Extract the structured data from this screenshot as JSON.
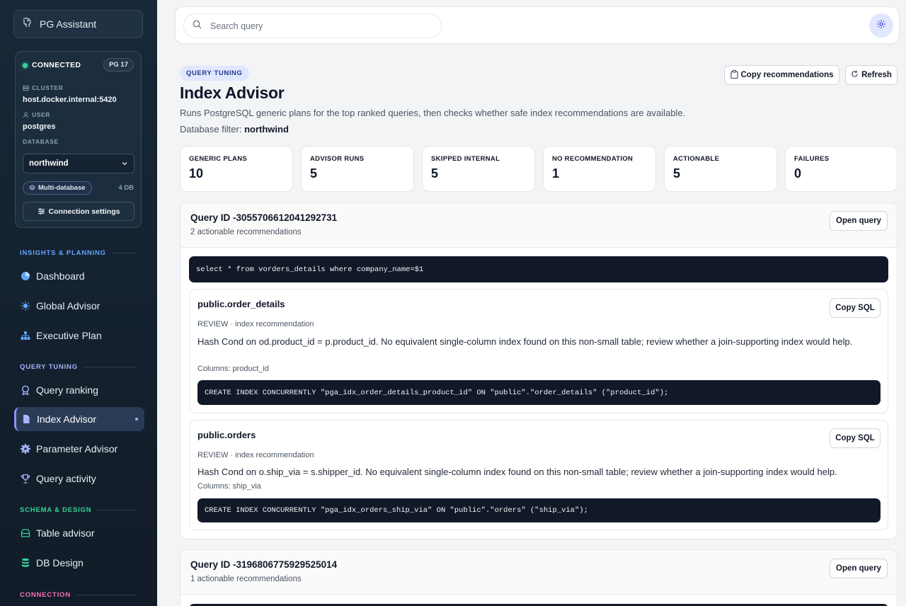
{
  "app": {
    "name": "PG Assistant"
  },
  "connection": {
    "status": "CONNECTED",
    "version": "PG 17",
    "cluster_label": "CLUSTER",
    "cluster": "host.docker.internal:5420",
    "user_label": "USER",
    "user": "postgres",
    "database_label": "DATABASE",
    "database": "northwind",
    "mode": "Multi-database",
    "db_count": "4 DB",
    "settings_label": "Connection settings"
  },
  "sidebar": {
    "sections": [
      {
        "title": "INSIGHTS & PLANNING",
        "color": "#60a5fa"
      },
      {
        "title": "QUERY TUNING",
        "color": "#a5b4fc"
      },
      {
        "title": "SCHEMA & DESIGN",
        "color": "#34d399"
      },
      {
        "title": "CONNECTION",
        "color": "#f472b6"
      }
    ],
    "items": [
      {
        "label": "Dashboard",
        "icon": "pie-chart-icon"
      },
      {
        "label": "Global Advisor",
        "icon": "sun-icon"
      },
      {
        "label": "Executive Plan",
        "icon": "hierarchy-icon"
      },
      {
        "label": "Query ranking",
        "icon": "award-icon"
      },
      {
        "label": "Index Advisor",
        "icon": "document-icon"
      },
      {
        "label": "Parameter Advisor",
        "icon": "gear-icon"
      },
      {
        "label": "Query activity",
        "icon": "trophy-icon"
      },
      {
        "label": "Table advisor",
        "icon": "table-icon"
      },
      {
        "label": "DB Design",
        "icon": "database-icon"
      }
    ],
    "active": "Index Advisor"
  },
  "search": {
    "placeholder": "Search query"
  },
  "page": {
    "badge": "QUERY TUNING",
    "title": "Index Advisor",
    "description": "Runs PostgreSQL generic plans for the top ranked queries, then checks whether safe index recommendations are available.",
    "filter_label": "Database filter:",
    "filter_value": "northwind",
    "copy_label": "Copy recommendations",
    "refresh_label": "Refresh"
  },
  "stats": [
    {
      "label": "GENERIC PLANS",
      "value": "10"
    },
    {
      "label": "ADVISOR RUNS",
      "value": "5"
    },
    {
      "label": "SKIPPED INTERNAL",
      "value": "5"
    },
    {
      "label": "NO RECOMMENDATION",
      "value": "1"
    },
    {
      "label": "ACTIONABLE",
      "value": "5"
    },
    {
      "label": "FAILURES",
      "value": "0"
    }
  ],
  "queries": [
    {
      "id": "Query ID -3055706612041292731",
      "summary": "2 actionable recommendations",
      "open_label": "Open query",
      "sql": "select * from vorders_details where company_name=$1",
      "recommendations": [
        {
          "table": "public.order_details",
          "meta": "REVIEW · index recommendation",
          "detail": "Hash Cond on od.product_id = p.product_id. No equivalent single-column index found on this non-small table; review whether a join-supporting index would help.",
          "columns": "Columns: product_id",
          "ddl": "CREATE INDEX CONCURRENTLY \"pga_idx_order_details_product_id\" ON \"public\".\"order_details\" (\"product_id\");",
          "copy_label": "Copy SQL"
        },
        {
          "table": "public.orders",
          "meta": "REVIEW · index recommendation",
          "detail": "Hash Cond on o.ship_via = s.shipper_id. No equivalent single-column index found on this non-small table; review whether a join-supporting index would help.",
          "columns": "Columns: ship_via",
          "ddl": "CREATE INDEX CONCURRENTLY \"pga_idx_orders_ship_via\" ON \"public\".\"orders\" (\"ship_via\");",
          "copy_label": "Copy SQL"
        }
      ]
    },
    {
      "id": "Query ID -3196806775929525014",
      "summary": "1 actionable recommendations",
      "open_label": "Open query"
    }
  ]
}
